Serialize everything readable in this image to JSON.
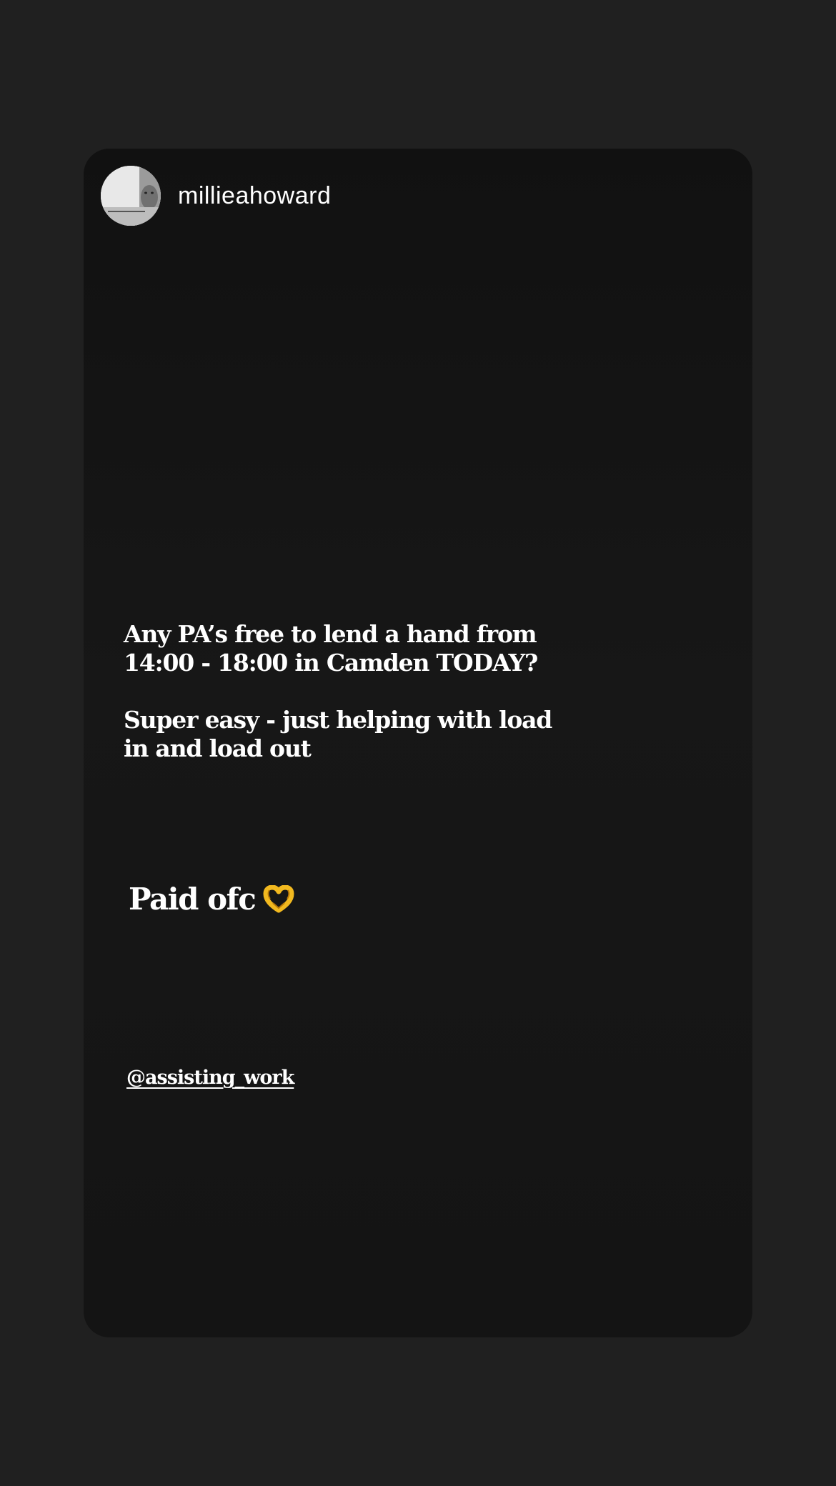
{
  "story": {
    "username": "millieahoward",
    "text_block_1": {
      "line_1": "Any PA’s free to lend a hand from",
      "line_2": "14:00 - 18:00 in Camden TODAY?"
    },
    "text_block_2": {
      "line_1": "Super easy - just helping with load",
      "line_2": "in and load out"
    },
    "paid_text": "Paid ofc",
    "paid_icon": "heart-hands-emoji",
    "mention": "@assisting_work"
  },
  "colors": {
    "page_background": "#202020",
    "card_background": "#161616",
    "text": "#ffffff",
    "emoji": "#f2b91f"
  }
}
